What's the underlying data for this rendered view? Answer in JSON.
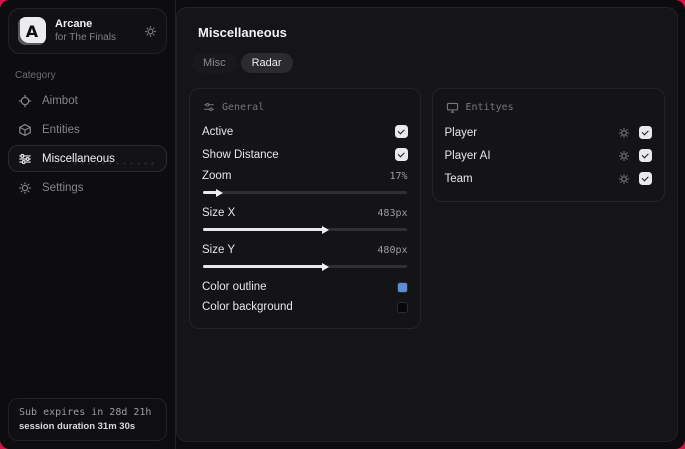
{
  "app": {
    "accent_color": "#d6134a"
  },
  "sidebar": {
    "logo": {
      "letter": "A",
      "title": "Arcane",
      "subtitle": "for The Finals"
    },
    "category_label": "Category",
    "items": [
      {
        "label": "Aimbot"
      },
      {
        "label": "Entities"
      },
      {
        "label": "Miscellaneous"
      },
      {
        "label": "Settings"
      }
    ],
    "footer": {
      "expiry": "Sub expires in 28d 21h",
      "session": "session duration 31m 30s"
    }
  },
  "main": {
    "title": "Miscellaneous",
    "tabs": [
      {
        "label": "Misc"
      },
      {
        "label": "Radar"
      }
    ],
    "active_tab": "Radar",
    "panels": {
      "general": {
        "header": "General",
        "active": {
          "label": "Active",
          "checked": true
        },
        "show_distance": {
          "label": "Show Distance",
          "checked": true
        },
        "zoom": {
          "label": "Zoom",
          "value": "17%",
          "percent": 8
        },
        "size_x": {
          "label": "Size X",
          "value": "483px",
          "percent": 60
        },
        "size_y": {
          "label": "Size Y",
          "value": "480px",
          "percent": 60
        },
        "color_outline": {
          "label": "Color outline",
          "color": "#5a8ed9"
        },
        "color_background": {
          "label": "Color background",
          "color": "#07070a"
        }
      },
      "entities": {
        "header": "Entityes",
        "rows": [
          {
            "label": "Player",
            "checked": true
          },
          {
            "label": "Player AI",
            "checked": true
          },
          {
            "label": "Team",
            "checked": true
          }
        ]
      }
    }
  }
}
